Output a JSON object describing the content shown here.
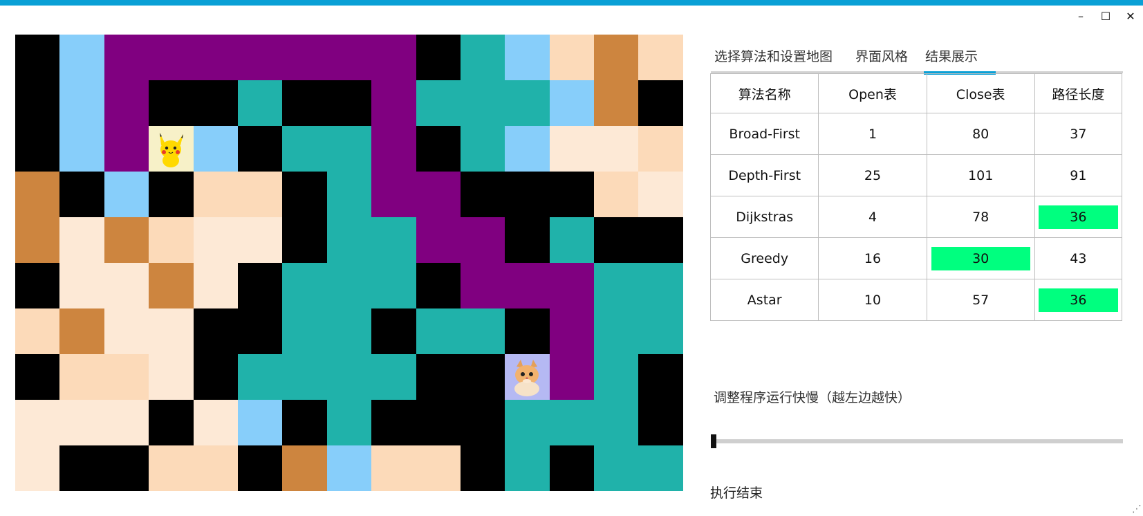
{
  "window": {
    "controls": [
      {
        "name": "minimize-button",
        "glyph": "–"
      },
      {
        "name": "maximize-button",
        "glyph": "☐"
      },
      {
        "name": "close-button",
        "glyph": "✕"
      }
    ]
  },
  "colors": {
    "accent": "#0aa0d6",
    "highlight": "#00ff7f",
    "k": "#000000",
    "b": "#87cefa",
    "p": "#800080",
    "t": "#20b2aa",
    "c": "#fde9d6",
    "s": "#fcdab9",
    "o": "#cd853f"
  },
  "maze": {
    "rows": [
      [
        "k",
        "b",
        "p",
        "p",
        "p",
        "p",
        "p",
        "p",
        "p",
        "k",
        "t",
        "b",
        "s",
        "o",
        "s"
      ],
      [
        "k",
        "b",
        "p",
        "k",
        "k",
        "t",
        "k",
        "k",
        "p",
        "t",
        "t",
        "t",
        "b",
        "o",
        "k"
      ],
      [
        "k",
        "b",
        "p",
        "P",
        "b",
        "k",
        "t",
        "t",
        "p",
        "k",
        "t",
        "b",
        "c",
        "c",
        "s"
      ],
      [
        "o",
        "k",
        "b",
        "k",
        "s",
        "s",
        "k",
        "t",
        "p",
        "p",
        "k",
        "k",
        "k",
        "s",
        "c"
      ],
      [
        "o",
        "c",
        "o",
        "s",
        "c",
        "c",
        "k",
        "t",
        "t",
        "p",
        "p",
        "k",
        "t",
        "k",
        "k"
      ],
      [
        "k",
        "c",
        "c",
        "o",
        "c",
        "k",
        "t",
        "t",
        "t",
        "k",
        "p",
        "p",
        "p",
        "t",
        "t"
      ],
      [
        "s",
        "o",
        "c",
        "c",
        "k",
        "k",
        "t",
        "t",
        "k",
        "t",
        "t",
        "k",
        "p",
        "t",
        "t"
      ],
      [
        "k",
        "s",
        "s",
        "c",
        "k",
        "t",
        "t",
        "t",
        "t",
        "k",
        "k",
        "C",
        "p",
        "t",
        "k"
      ],
      [
        "c",
        "c",
        "c",
        "k",
        "c",
        "b",
        "k",
        "t",
        "k",
        "k",
        "k",
        "t",
        "t",
        "t",
        "k"
      ],
      [
        "c",
        "k",
        "k",
        "s",
        "s",
        "k",
        "o",
        "b",
        "s",
        "s",
        "k",
        "t",
        "k",
        "t",
        "t"
      ]
    ],
    "start_icon": "pikachu-icon",
    "goal_icon": "cat-icon"
  },
  "tabs": [
    {
      "label": "选择算法和设置地图"
    },
    {
      "label": "界面风格"
    },
    {
      "label": "结果展示",
      "active": true
    }
  ],
  "table": {
    "headers": [
      "算法名称",
      "Open表",
      "Close表",
      "路径长度"
    ],
    "rows": [
      {
        "name": "Broad-First",
        "open": "1",
        "close": "80",
        "length": "37",
        "hl_close": false,
        "hl_length": false
      },
      {
        "name": "Depth-First",
        "open": "25",
        "close": "101",
        "length": "91",
        "hl_close": false,
        "hl_length": false
      },
      {
        "name": "Dijkstras",
        "open": "4",
        "close": "78",
        "length": "36",
        "hl_close": false,
        "hl_length": true
      },
      {
        "name": "Greedy",
        "open": "16",
        "close": "30",
        "length": "43",
        "hl_close": true,
        "hl_length": false
      },
      {
        "name": "Astar",
        "open": "10",
        "close": "57",
        "length": "36",
        "hl_close": false,
        "hl_length": true
      }
    ]
  },
  "speed": {
    "label": "调整程序运行快慢（越左边越快）",
    "value": 0.0
  },
  "status": "执行结束"
}
